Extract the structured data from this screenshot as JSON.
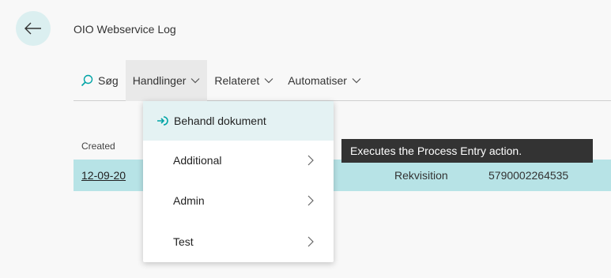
{
  "page": {
    "title": "OIO Webservice Log"
  },
  "actionbar": {
    "search": "Søg",
    "actions": "Handlinger",
    "related": "Relateret",
    "automate": "Automatiser"
  },
  "list": {
    "columns": [
      "Created"
    ],
    "row": {
      "created": "12-09-20",
      "type": "Rekvisition",
      "number": "5790002264535"
    }
  },
  "menu": {
    "items": [
      {
        "label": "Behandl dokument",
        "icon": "process-document-icon"
      },
      {
        "label": "Additional",
        "icon": "chevron-right-icon"
      },
      {
        "label": "Admin",
        "icon": "chevron-right-icon"
      },
      {
        "label": "Test",
        "icon": "chevron-right-icon"
      }
    ]
  },
  "tooltip": {
    "text": "Executes the Process Entry action."
  },
  "colors": {
    "accent": "#00a4a6",
    "row_selected": "#b7e3e6",
    "back_button_bg": "#dbeff0",
    "tooltip_bg": "#333333"
  }
}
